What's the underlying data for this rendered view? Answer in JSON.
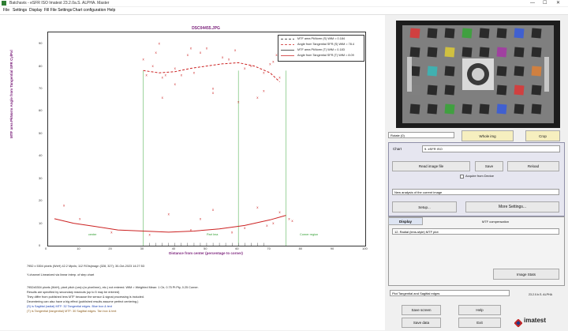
{
  "window": {
    "title": "Batchavis - eSFR ISO  Imatest 23.2.0a.S. ALPHA. Master",
    "minimize": "—",
    "maximize": "☐",
    "close": "✕"
  },
  "menu": [
    "File",
    "Settings",
    "Display",
    "Fill File Settings",
    "Chart configuration",
    "Help"
  ],
  "plot": {
    "title": "DSC04455.JPG",
    "legend": [
      {
        "label": "MTF area PkNorm (S)  WtM = 0.184",
        "color": "#222222",
        "dash": "3,2"
      },
      {
        "label": "Angle from Tangential SFR (S)  WtM = 78.4",
        "color": "#cc2222",
        "dash": "3,2"
      },
      {
        "label": "MTF area PkNorm (T)  WtM = 0.183",
        "color": "#222222",
        "dash": ""
      },
      {
        "label": "Angle from Tangential SFR (T)  WtM = 8.09",
        "color": "#cc2222",
        "dash": ""
      }
    ],
    "region_labels": [
      "center",
      "Part Ima",
      "Corner region"
    ]
  },
  "chart_data": {
    "type": "scatter",
    "title": "DSC04455.JPG",
    "xlabel": "Distance from center (percentage to corner)",
    "ylabel": "MTF area PkNorm   Angle from Tangential SFR    Cy/Pxl",
    "xlim": [
      0,
      100
    ],
    "ylim": [
      0,
      95
    ],
    "xticks": [
      0,
      10,
      20,
      30,
      40,
      50,
      60,
      70,
      80,
      90,
      100
    ],
    "yticks": [
      0,
      10,
      20,
      30,
      40,
      50,
      60,
      70,
      80,
      90
    ],
    "vlines": [
      30,
      60,
      75
    ],
    "series": [
      {
        "name": "Angle from Tangential SFR (S)  WtM = 78.4",
        "kind": "dash-curve",
        "color": "#cc2222",
        "x": [
          30,
          35,
          40,
          45,
          50,
          55,
          60,
          65,
          70,
          73
        ],
        "y": [
          78,
          77,
          77.5,
          79,
          80,
          81,
          81.5,
          80,
          77,
          73
        ]
      },
      {
        "name": "Angle from Tangential SFR (T)  WtM = 8.09",
        "kind": "curve",
        "color": "#cc2222",
        "x": [
          2,
          8,
          15,
          22,
          30,
          38,
          46,
          54,
          62,
          70,
          75
        ],
        "y": [
          12,
          10,
          8.5,
          7,
          6.5,
          6,
          6.5,
          7.5,
          9,
          11.5,
          13.5
        ]
      },
      {
        "name": "points",
        "kind": "points",
        "color": "#cc2222",
        "x": [
          30,
          31,
          33,
          34,
          35,
          36,
          37,
          40,
          42,
          44,
          46,
          48,
          50,
          52,
          55,
          57,
          59,
          62,
          64,
          66,
          68,
          70,
          71,
          72,
          73,
          36,
          40,
          45,
          52,
          60,
          68
        ],
        "y": [
          83,
          76,
          80,
          86,
          90,
          75,
          76,
          79,
          76,
          85,
          77,
          86,
          88,
          68,
          84,
          83,
          87,
          79,
          80,
          66,
          69,
          81,
          82,
          85,
          75,
          66,
          72,
          88,
          70,
          64,
          77
        ]
      },
      {
        "name": "low points",
        "kind": "points",
        "color": "#cc2222",
        "x": [
          5,
          10,
          20,
          32,
          38,
          45,
          48,
          52,
          58,
          62,
          66,
          69,
          71,
          73,
          76,
          77
        ],
        "y": [
          18,
          12,
          6,
          5,
          14,
          7,
          12,
          16,
          6,
          8,
          17,
          9,
          10,
          15,
          12,
          11
        ]
      },
      {
        "name": "axis marks",
        "kind": "points",
        "color": "#111111",
        "x": [
          32,
          34,
          36,
          38,
          40,
          42,
          44,
          46,
          48,
          50,
          52,
          54,
          56,
          58,
          60,
          62,
          64,
          66,
          68
        ],
        "y": [
          0.5,
          0.5,
          0.5,
          0.5,
          0.5,
          0.5,
          0.5,
          0.5,
          0.5,
          0.5,
          0.5,
          0.5,
          0.5,
          0.5,
          0.5,
          0.5,
          0.5,
          0.5,
          0.5
        ]
      }
    ]
  },
  "info": {
    "line1": "7952 x 5304 pixels (WxH)   42.2 Mpxls;   112 ROIs(magn (328, 327);   30-Oct-2023 14:27:53",
    "line2": "Y-channel    Linearized via linear interp. of step chart",
    "line3": "7952x5304 pixels (WxH), pixel pitch (um)=(ro pixel/mm), etc.) not entered.   WtM = Weighted Mean: 1 Ctr, 0.75 Pt Pty, 0.25 Corner.",
    "line4": "Results are specified by secondary readouts (up to 5 may be entered)",
    "line5": "They differ from published lens MTF because the sensor & signal processing is included.",
    "line6": "Decentering can also have a big effect (published results assume perfect centering.)",
    "line7": "(S) is Sagittal (radial) MTF:        32 Tangential edges.  Blue box & text",
    "line8": "(T) is Tangential (tangential) MTF:  30 Sagittal edges.  Tan box & text"
  },
  "right": {
    "rotate_select": "Rotate (0)",
    "whole_img": "Whole img",
    "crop": "Crop",
    "chart_label": "Chart",
    "chart_select": "9. eSFR ISO",
    "read_image": "Read image file",
    "save": "Save",
    "reload": "Reload",
    "acquire_label": "Acquire from Device",
    "analysis_select": "New analysis of the current image",
    "setup": "Setup...",
    "more_settings": "More Settings...",
    "tab_display": "Display",
    "tab_mtf": "MTF compensation",
    "display_select": "12. Radial (lens-style) MTF plot",
    "image_stats": "Image Stats",
    "bottom_select": "Plot Tangential and Sagittal edges",
    "version": "23.2.0.b.S. ALPHA",
    "save_screen": "Save screen",
    "help": "Help",
    "save_data": "Save data",
    "exit": "Exit",
    "logo": "imatest"
  }
}
